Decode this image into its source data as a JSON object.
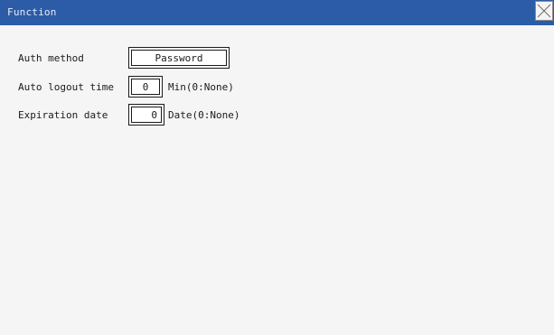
{
  "window": {
    "title": "Function"
  },
  "settings": {
    "auth_method": {
      "label": "Auth method",
      "value": "Password"
    },
    "auto_logout": {
      "label": "Auto logout time",
      "value": "0",
      "unit": "Min(0:None)"
    },
    "expiration": {
      "label": "Expiration date",
      "value": "0",
      "unit": "Date(0:None)"
    }
  },
  "colors": {
    "titlebar": "#2c5ca8",
    "background": "#f5f5f5"
  }
}
